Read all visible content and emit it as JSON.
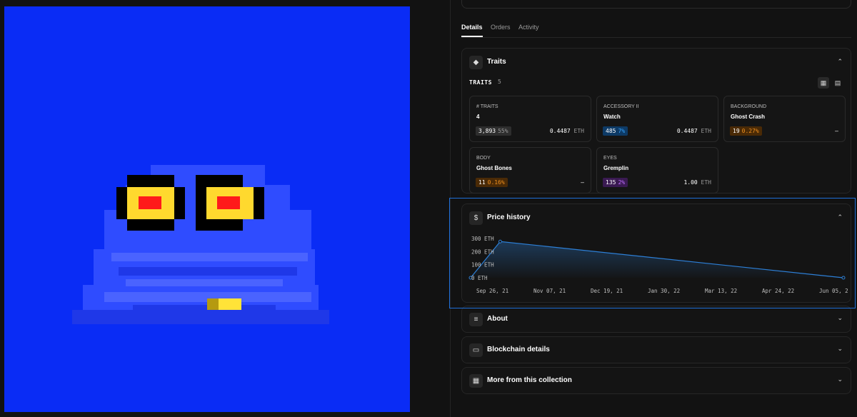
{
  "tabs": [
    {
      "label": "Details",
      "active": true
    },
    {
      "label": "Orders",
      "active": false
    },
    {
      "label": "Activity",
      "active": false
    }
  ],
  "traits_section": {
    "title": "Traits",
    "icon": "diamond-icon",
    "label": "TRAITS",
    "count": "5",
    "traits": [
      {
        "type": "# TRAITS",
        "value": "4",
        "count": "3,893",
        "percent": "55%",
        "price": "0.4487",
        "unit": "ETH",
        "badge_color": "gray"
      },
      {
        "type": "ACCESSORY II",
        "value": "Watch",
        "count": "485",
        "percent": "7%",
        "price": "0.4487",
        "unit": "ETH",
        "badge_color": "blue"
      },
      {
        "type": "BACKGROUND",
        "value": "Ghost Crash",
        "count": "19",
        "percent": "0.27%",
        "price": "–",
        "unit": "",
        "badge_color": "orange"
      },
      {
        "type": "BODY",
        "value": "Ghost Bones",
        "count": "11",
        "percent": "0.16%",
        "price": "–",
        "unit": "",
        "badge_color": "orange"
      },
      {
        "type": "EYES",
        "value": "Gremplin",
        "count": "135",
        "percent": "2%",
        "price": "1.00",
        "unit": "ETH",
        "badge_color": "purple"
      }
    ]
  },
  "price_history": {
    "title": "Price history",
    "icon": "dollar-icon"
  },
  "chart_data": {
    "type": "line",
    "x": [
      "2021-09-26",
      "2021-10-16",
      "2022-06-05"
    ],
    "y": [
      0,
      277,
      0
    ],
    "xlim": [
      "2021-09-26",
      "2022-06-05"
    ],
    "ylim": [
      0,
      300
    ],
    "y_ticks": [
      "300 ETH",
      "200 ETH",
      "100 ETH",
      "0 ETH"
    ],
    "x_ticks": [
      "Sep 26, 21",
      "Nov 07, 21",
      "Dec 19, 21",
      "Jan 30, 22",
      "Mar 13, 22",
      "Apr 24, 22",
      "Jun 05, 2"
    ],
    "color": "#2d7fd6"
  },
  "sections": [
    {
      "title": "About",
      "icon": "text-lines-icon"
    },
    {
      "title": "Blockchain details",
      "icon": "table-icon"
    },
    {
      "title": "More from this collection",
      "icon": "grid-icon"
    }
  ],
  "colors": {
    "artwork_background": "#0a2cf5",
    "focus": "#1e6fd9"
  }
}
